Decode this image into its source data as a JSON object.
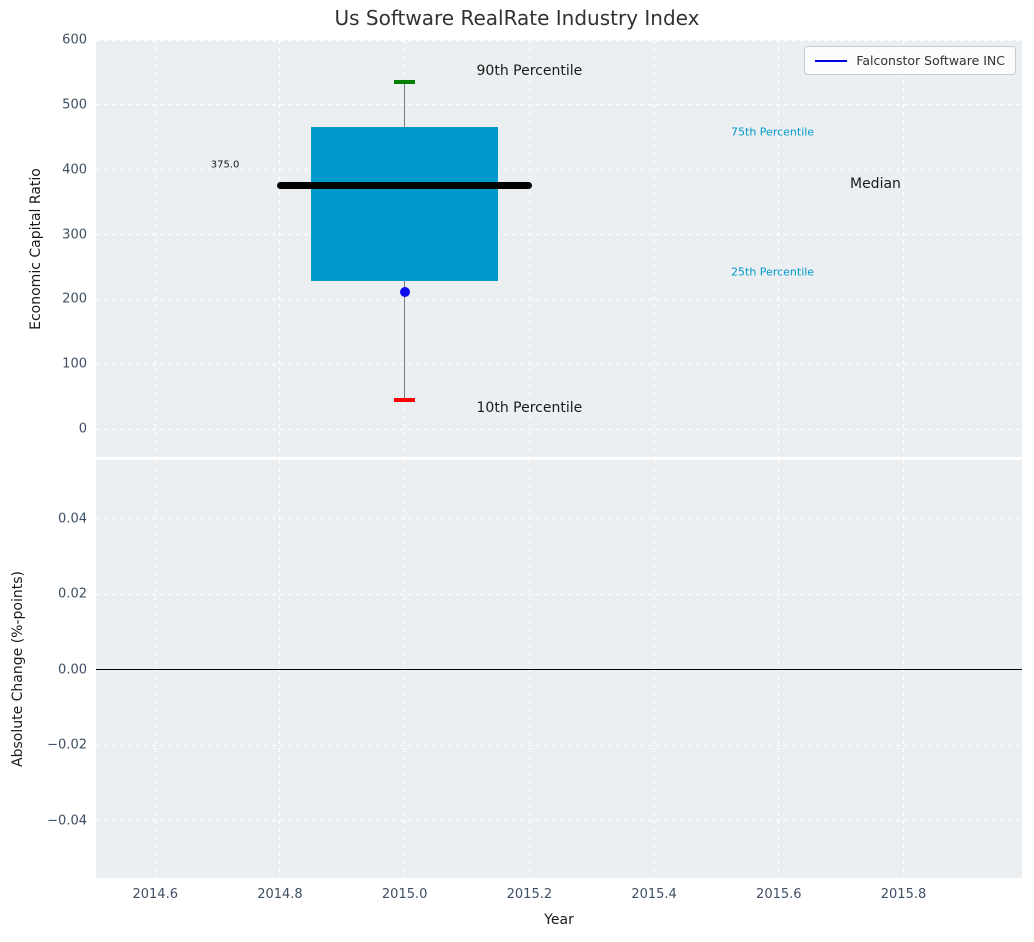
{
  "title": "Us Software RealRate Industry Index",
  "legend": {
    "label": "Falconstor Software INC",
    "line_color": "#0000dd"
  },
  "colors": {
    "axes_bg": "#eceff1",
    "grid": "#ffffff",
    "box_fill": "#0099cc",
    "median_line": "#000000",
    "whisker": "#7a7a7a",
    "cap_top": "#008000",
    "cap_bottom": "#ff0000",
    "company_point": "#0d0dee",
    "zero_line": "#000000",
    "tick_label": "#3d4f63",
    "annotation_dark": "#1a1a1a",
    "annotation_cyan": "#0099cc"
  },
  "chart_data": [
    {
      "type": "boxplot",
      "ylabel": "Economic Capital Ratio",
      "xlim": [
        2014.505,
        2015.99
      ],
      "ylim": [
        -43,
        600
      ],
      "yticks": [
        0,
        100,
        200,
        300,
        400,
        500,
        600
      ],
      "ytick_labels": [
        "0",
        "100",
        "200",
        "300",
        "400",
        "500",
        "600"
      ],
      "xticks": [
        2014.6,
        2014.8,
        2015.0,
        2015.2,
        2015.4,
        2015.6,
        2015.8
      ],
      "xtick_labels": [],
      "xtick_labels_visible": false,
      "grid": true,
      "box": {
        "x": 2015.0,
        "p10": 45,
        "p25": 228,
        "median": 375,
        "p75": 466,
        "p90": 535,
        "box_half_width": 0.15,
        "median_half_width": 0.205,
        "cap_half_width": 0.017
      },
      "company_point": {
        "x": 2015.0,
        "y": 212,
        "series": "Falconstor Software INC"
      },
      "annotations": [
        {
          "text": "375.0",
          "x": 2014.712,
          "y": 407,
          "size": 10,
          "color": "#1a1a1a"
        },
        {
          "text": "90th Percentile",
          "x": 2015.2,
          "y": 552,
          "size": 14,
          "color": "#1a1a1a"
        },
        {
          "text": "10th Percentile",
          "x": 2015.2,
          "y": 33,
          "size": 14,
          "color": "#1a1a1a"
        },
        {
          "text": "75th Percentile",
          "x": 2015.59,
          "y": 458,
          "size": 11,
          "color": "#0099cc"
        },
        {
          "text": "25th Percentile",
          "x": 2015.59,
          "y": 242,
          "size": 11,
          "color": "#0099cc"
        },
        {
          "text": "Median",
          "x": 2015.755,
          "y": 378,
          "size": 14,
          "color": "#1a1a1a"
        }
      ]
    },
    {
      "type": "line",
      "ylabel": "Absolute Change (%-points)",
      "xlabel": "Year",
      "xlim": [
        2014.505,
        2015.99
      ],
      "ylim": [
        -0.0552,
        0.0555
      ],
      "yticks": [
        0.04,
        0.02,
        0.0,
        -0.02,
        -0.04
      ],
      "ytick_labels": [
        "0.04",
        "0.02",
        "0.00",
        "−0.02",
        "−0.04"
      ],
      "xticks": [
        2014.6,
        2014.8,
        2015.0,
        2015.2,
        2015.4,
        2015.6,
        2015.8
      ],
      "xtick_labels": [
        "2014.6",
        "2014.8",
        "2015.0",
        "2015.2",
        "2015.4",
        "2015.6",
        "2015.8"
      ],
      "xtick_labels_visible": true,
      "grid": true,
      "zero_line_y": 0.0,
      "series": []
    }
  ]
}
